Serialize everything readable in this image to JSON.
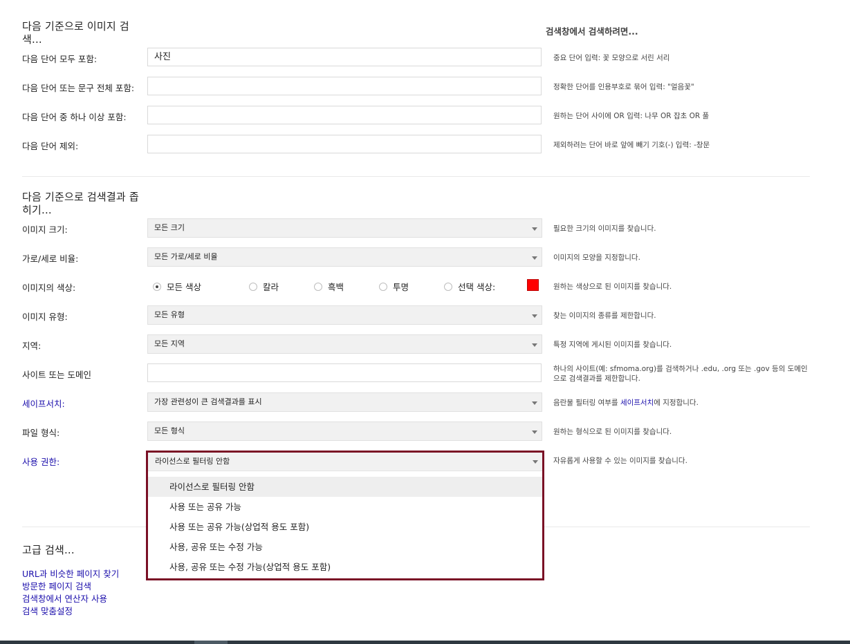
{
  "search_section": {
    "title": "다음 기준으로 이미지 검색...",
    "hint_heading": "검색창에서 검색하려면...",
    "rows": [
      {
        "label": "다음 단어 모두 포함:",
        "value": "사진",
        "hint": "중요 단어 입력: 꽃 모양으로 서린 서리"
      },
      {
        "label": "다음 단어 또는 문구 전체 포함:",
        "value": "",
        "hint": "정확한 단어를 인용부호로 묶어 입력: \"얼음꽃\""
      },
      {
        "label": "다음 단어 중 하나 이상 포함:",
        "value": "",
        "hint": "원하는 단어 사이에 OR 입력: 나무 OR 잡초 OR 풀"
      },
      {
        "label": "다음 단어 제외:",
        "value": "",
        "hint": "제외하려는 단어 바로 앞에 빼기 기호(-) 입력: -창문"
      }
    ]
  },
  "narrow_section": {
    "title": "다음 기준으로 검색결과 좁히기...",
    "size": {
      "label": "이미지 크기:",
      "value": "모든 크기",
      "hint": "필요한 크기의 이미지를 찾습니다."
    },
    "aspect": {
      "label": "가로/세로 비율:",
      "value": "모든 가로/세로 비율",
      "hint": "이미지의 모양을 지정합니다."
    },
    "color": {
      "label": "이미지의 색상:",
      "options": [
        "모든 색상",
        "칼라",
        "흑백",
        "투명",
        "선택 색상:"
      ],
      "selected": "모든 색상",
      "swatch_color": "#ff0000",
      "hint": "원하는 색상으로 된 이미지를 찾습니다."
    },
    "type": {
      "label": "이미지 유형:",
      "value": "모든 유형",
      "hint": "찾는 이미지의 종류를 제한합니다."
    },
    "region": {
      "label": "지역:",
      "value": "모든 지역",
      "hint": "특정 지역에 게시된 이미지를 찾습니다."
    },
    "site": {
      "label": "사이트 또는 도메인",
      "value": "",
      "hint": "하나의 사이트(예: sfmoma.org)를 검색하거나 .edu, .org 또는 .gov 등의 도메인으로 검색결과를 제한합니다."
    },
    "safesearch": {
      "label": "세이프서치:",
      "value": "가장 관련성이 큰 검색결과를 표시",
      "hint_pre": "음란물 필터링 여부를 ",
      "hint_link": "세이프서치",
      "hint_post": "에 지정합니다."
    },
    "filetype": {
      "label": "파일 형식:",
      "value": "모든 형식",
      "hint": "원하는 형식으로 된 이미지를 찾습니다."
    },
    "rights": {
      "label": "사용 권한:",
      "value": "라이선스로 필터링 안함",
      "hint": "자유롭게 사용할 수 있는 이미지를 찾습니다.",
      "options": [
        "라이선스로 필터링 안함",
        "사용 또는 공유 가능",
        "사용 또는 공유 가능(상업적 용도 포함)",
        "사용, 공유 또는 수정 가능",
        "사용, 공유 또는 수정 가능(상업적 용도 포함)"
      ]
    }
  },
  "advanced": {
    "title": "고급 검색...",
    "links": [
      "URL과 비슷한 페이지 찾기",
      "방문한 페이지 검색",
      "검색창에서 연산자 사용",
      "검색 맞춤설정"
    ]
  }
}
